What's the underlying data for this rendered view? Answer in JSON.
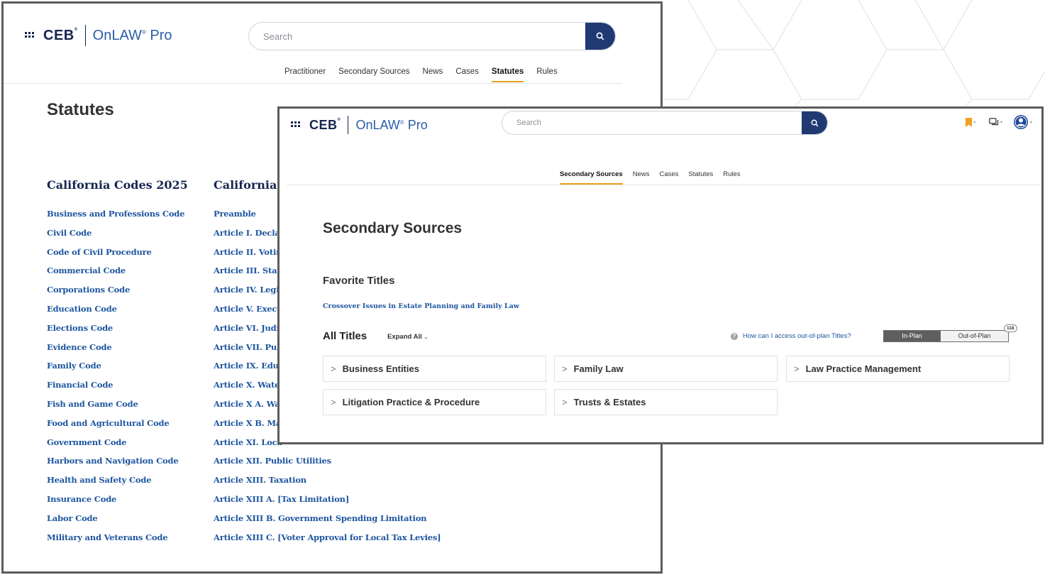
{
  "brand": {
    "ceb": "CEB",
    "ceb_mark": "®",
    "product": "OnLAW",
    "product_mark": "®",
    "product_suffix": "Pro"
  },
  "back_window": {
    "search_placeholder": "Search",
    "nav_tabs": [
      "Practitioner",
      "Secondary Sources",
      "News",
      "Cases",
      "Statutes",
      "Rules"
    ],
    "active_tab": "Statutes",
    "page_title": "Statutes",
    "columns": [
      {
        "heading": "California Codes 2025",
        "links": [
          "Business and Professions Code",
          "Civil Code",
          "Code of Civil Procedure",
          "Commercial Code",
          "Corporations Code",
          "Education Code",
          "Elections Code",
          "Evidence Code",
          "Family Code",
          "Financial Code",
          "Fish and Game Code",
          "Food and Agricultural Code",
          "Government Code",
          "Harbors and Navigation Code",
          "Health and Safety Code",
          "Insurance Code",
          "Labor Code",
          "Military and Veterans Code"
        ]
      },
      {
        "heading": "California C",
        "links": [
          "Preamble",
          "Article I. Declar",
          "Article II. Votin",
          "Article III. State",
          "Article IV. Legis",
          "Article V. Execu",
          "Article VI. Judic",
          "Article VII. Pub",
          "Article IX. Educ",
          "Article X. Wate",
          "Article X A. Wa",
          "Article X B. Mar",
          "Article XI. Loca",
          "Article XII. Public Utilities",
          "Article XIII. Taxation",
          "Article XIII A. [Tax Limitation]",
          "Article XIII B. Government Spending Limitation",
          "Article XIII C. [Voter Approval for Local Tax Levies]"
        ]
      }
    ]
  },
  "front_window": {
    "search_placeholder": "Search",
    "nav_tabs": [
      "Secondary Sources",
      "News",
      "Cases",
      "Statutes",
      "Rules"
    ],
    "active_tab": "Secondary Sources",
    "header_icons": [
      "bookmark-icon",
      "chat-icon",
      "user-avatar-icon"
    ],
    "page_title": "Secondary Sources",
    "favorites_heading": "Favorite Titles",
    "favorite_link": "Crossover Issues in Estate Planning and Family Law",
    "all_titles_heading": "All Titles",
    "expand_all": "Expand All",
    "oop_help": "How can I access out-of-plan Titles?",
    "toggle": {
      "in_plan": "In-Plan",
      "out_of_plan": "Out-of-Plan",
      "count": "118"
    },
    "categories": [
      "Business Entities",
      "Family Law",
      "Law Practice Management",
      "Litigation Practice & Procedure",
      "Trusts & Estates"
    ]
  },
  "colors": {
    "brand_navy": "#16254f",
    "link_blue": "#1e56a0",
    "accent": "#e8a21a",
    "bookmark": "#f0a020",
    "search_button": "#1f3a73"
  }
}
